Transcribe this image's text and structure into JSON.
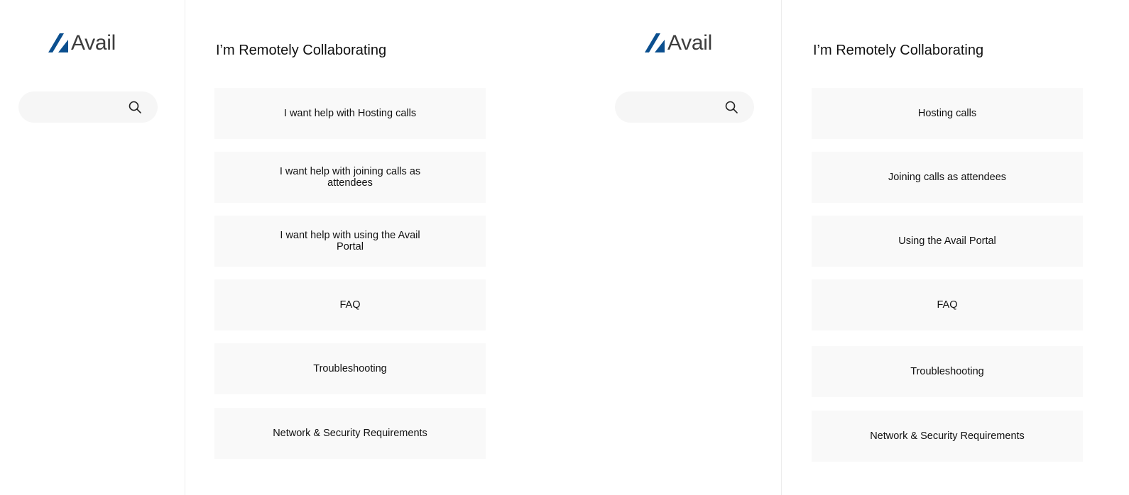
{
  "brand": {
    "logo_text": "Avail",
    "logo_color": "#0b4f8f"
  },
  "left": {
    "title": "I’m Remotely Collaborating",
    "search": {
      "placeholder": ""
    },
    "cards": [
      {
        "label": "I want help with Hosting calls"
      },
      {
        "label": "I want help with joining calls as attendees"
      },
      {
        "label": "I want help with using the Avail Portal"
      },
      {
        "label": "FAQ"
      },
      {
        "label": "Troubleshooting"
      },
      {
        "label": "Network & Security Requirements"
      }
    ]
  },
  "right": {
    "title": "I’m Remotely Collaborating",
    "search": {
      "placeholder": ""
    },
    "cards": [
      {
        "label": "Hosting calls"
      },
      {
        "label": "Joining calls as attendees"
      },
      {
        "label": "Using the Avail Portal"
      },
      {
        "label": "FAQ"
      },
      {
        "label": "Troubleshooting"
      },
      {
        "label": "Network & Security Requirements"
      }
    ]
  }
}
